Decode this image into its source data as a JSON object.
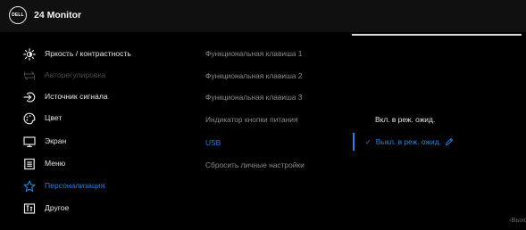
{
  "header": {
    "logo_text": "DELL",
    "title": "24 Monitor"
  },
  "menu": {
    "items": [
      {
        "label": "Яркость / контрастность",
        "icon": "brightness-icon",
        "state": "normal"
      },
      {
        "label": "Авторегулировка",
        "icon": "auto-adjust-icon",
        "state": "disabled"
      },
      {
        "label": "Источник сигнала",
        "icon": "input-source-icon",
        "state": "normal"
      },
      {
        "label": "Цвет",
        "icon": "color-icon",
        "state": "normal"
      },
      {
        "label": "Экран",
        "icon": "display-icon",
        "state": "normal"
      },
      {
        "label": "Меню",
        "icon": "menu-icon",
        "state": "normal"
      },
      {
        "label": "Персонализация",
        "icon": "star-icon",
        "state": "active"
      },
      {
        "label": "Другое",
        "icon": "others-icon",
        "state": "normal"
      }
    ]
  },
  "submenu": {
    "items": [
      {
        "label": "Функциональная клавиша 1"
      },
      {
        "label": "Функциональная клавиша 2"
      },
      {
        "label": "Функциональная клавиша 3"
      },
      {
        "label": "Индикатор кнопки питания"
      },
      {
        "label": "USB",
        "active": true
      },
      {
        "label": "Сбросить личные настройки"
      }
    ]
  },
  "options": {
    "on_in_standby": "Вкл. в реж. ожид.",
    "off_in_standby": "Выкл. в реж. ожид.",
    "selected_check": "✓"
  },
  "footer": {
    "exit_label": "Выход"
  },
  "colors": {
    "accent": "#2a83e0",
    "text": "#e6e6e6",
    "muted": "#8a8a8a",
    "disabled": "#4a4a4a",
    "background": "#000000"
  }
}
